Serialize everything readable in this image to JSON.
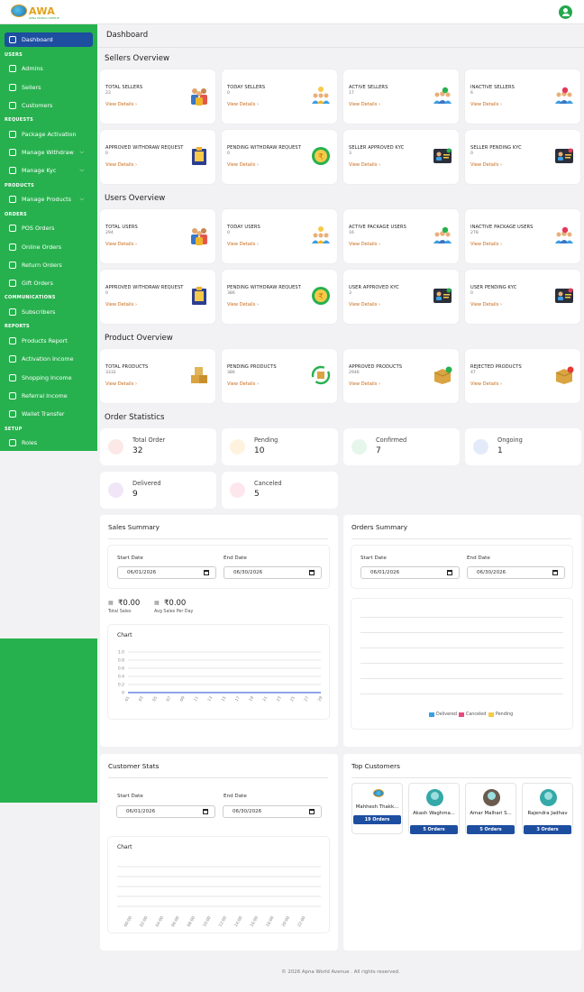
{
  "app": {
    "brand": "AWA",
    "tagline": "APNA WORLD AVENUE",
    "page_title": "Dashboard"
  },
  "sidebar": {
    "sections": [
      "USERS",
      "REQUESTS",
      "PRODUCTS",
      "ORDERS",
      "COMMUNICATIONS",
      "REPORTS",
      "SETUP"
    ],
    "items": [
      {
        "label": "Dashboard",
        "icon": "grid-icon"
      },
      {
        "label": "Admins",
        "icon": "admin-icon"
      },
      {
        "label": "Sellers",
        "icon": "sellers-icon"
      },
      {
        "label": "Customers",
        "icon": "customers-icon"
      },
      {
        "label": "Package Activation",
        "icon": "package-icon"
      },
      {
        "label": "Manage Withdraw",
        "icon": "withdraw-icon"
      },
      {
        "label": "Manage Kyc",
        "icon": "kyc-icon"
      },
      {
        "label": "Manage Products",
        "icon": "products-icon"
      },
      {
        "label": "POS Orders",
        "icon": "pos-icon"
      },
      {
        "label": "Online Orders",
        "icon": "online-orders-icon"
      },
      {
        "label": "Return Orders",
        "icon": "return-icon"
      },
      {
        "label": "Gift Orders",
        "icon": "gift-icon"
      },
      {
        "label": "Subscribers",
        "icon": "subscribers-icon"
      },
      {
        "label": "Products Report",
        "icon": "report-icon"
      },
      {
        "label": "Activation Income",
        "icon": "activation-icon"
      },
      {
        "label": "Shopping Income",
        "icon": "shopping-icon"
      },
      {
        "label": "Referral Income",
        "icon": "referral-icon"
      },
      {
        "label": "Wallet Transfer",
        "icon": "wallet-icon"
      },
      {
        "label": "Roles",
        "icon": "roles-icon"
      }
    ]
  },
  "sections": {
    "sellers": "Sellers Overview",
    "users": "Users Overview",
    "products": "Product Overview",
    "orders": "Order Statistics"
  },
  "view_details": "View Details",
  "sellers_cards": [
    {
      "label": "TOTAL SELLERS",
      "value": "23"
    },
    {
      "label": "TODAY SELLERS",
      "value": "0"
    },
    {
      "label": "ACTIVE SELLERS",
      "value": "17"
    },
    {
      "label": "INACTIVE SELLERS",
      "value": "6"
    },
    {
      "label": "APPROVED WITHDRAW REQUEST",
      "value": "0"
    },
    {
      "label": "PENDING WITHDRAW REQUEST",
      "value": "0"
    },
    {
      "label": "SELLER APPROVED KYC",
      "value": "3"
    },
    {
      "label": "SELLER PENDING KYC",
      "value": "0"
    }
  ],
  "users_cards": [
    {
      "label": "TOTAL USERS",
      "value": "294"
    },
    {
      "label": "TODAY USERS",
      "value": "0"
    },
    {
      "label": "ACTIVE PACKAGE USERS",
      "value": "16"
    },
    {
      "label": "INACTIVE PACKAGE USERS",
      "value": "278"
    },
    {
      "label": "APPROVED WITHDRAW REQUEST",
      "value": "0"
    },
    {
      "label": "PENDING WITHDRAW REQUEST",
      "value": "386"
    },
    {
      "label": "USER APPROVED KYC",
      "value": "3"
    },
    {
      "label": "USER PENDING KYC",
      "value": "0"
    }
  ],
  "product_cards": [
    {
      "label": "TOTAL PRODUCTS",
      "value": "3332"
    },
    {
      "label": "PENDING PRODUCTS",
      "value": "386"
    },
    {
      "label": "APPROVED PRODUCTS",
      "value": "2946"
    },
    {
      "label": "REJECTED PRODUCTS",
      "value": "47"
    }
  ],
  "order_stats": [
    {
      "label": "Total Order",
      "value": "32",
      "color": "#e53935"
    },
    {
      "label": "Pending",
      "value": "10",
      "color": "#f5a623"
    },
    {
      "label": "Confirmed",
      "value": "7",
      "color": "#27b14e"
    },
    {
      "label": "Ongoing",
      "value": "1",
      "color": "#1d4ea0"
    },
    {
      "label": "Delivered",
      "value": "9",
      "color": "#8e44ad"
    },
    {
      "label": "Canceled",
      "value": "5",
      "color": "#e53958"
    }
  ],
  "sales_summary": {
    "title": "Sales Summary",
    "start_label": "Start Date",
    "start_value": "06/01/2026",
    "end_label": "End Date",
    "end_value": "06/30/2026",
    "total_sales": "₹0.00",
    "total_sales_label": "Total Sales",
    "avg_sales": "₹0.00",
    "avg_sales_label": "Avg Sales Per Day",
    "chart_title": "Chart"
  },
  "orders_summary": {
    "title": "Orders Summary",
    "start_label": "Start Date",
    "start_value": "06/01/2026",
    "end_label": "End Date",
    "end_value": "06/30/2026"
  },
  "customer_stats": {
    "title": "Customer Stats",
    "start_label": "Start Date",
    "start_value": "06/01/2026",
    "end_label": "End Date",
    "end_value": "06/30/2026",
    "chart_title": "Chart"
  },
  "top_customers": {
    "title": "Top Customers",
    "items": [
      {
        "name": "Mahhesh Thakk...",
        "orders": "19 Orders"
      },
      {
        "name": "Akash Waghma...",
        "orders": "5 Orders"
      },
      {
        "name": "Amar Malhari S...",
        "orders": "5 Orders"
      },
      {
        "name": "Rajendra Jadhav",
        "orders": "3 Orders"
      }
    ]
  },
  "chart_data": [
    {
      "type": "line",
      "title": "Chart",
      "x": [
        "01",
        "03",
        "05",
        "07",
        "09",
        "11",
        "13",
        "15",
        "17",
        "19",
        "21",
        "23",
        "25",
        "27",
        "29"
      ],
      "series": [
        {
          "values": [
            0,
            0,
            0,
            0,
            0,
            0,
            0,
            0,
            0,
            0,
            0,
            0,
            0,
            0,
            0
          ]
        }
      ],
      "yticks": [
        "1.0",
        "0.8",
        "0.6",
        "0.4",
        "0.2",
        "0"
      ],
      "ylim": [
        0,
        1
      ]
    },
    {
      "type": "bar",
      "legend": [
        "Delivered",
        "Canceled",
        "Pending"
      ],
      "legend_colors": [
        "#3a9ee4",
        "#e84a7f",
        "#f7c948"
      ],
      "legend_position": "bottom",
      "series": [
        {
          "name": "Delivered",
          "values": []
        },
        {
          "name": "Canceled",
          "values": []
        },
        {
          "name": "Pending",
          "values": []
        }
      ]
    },
    {
      "type": "line",
      "title": "Chart",
      "x": [
        "00:00",
        "02:00",
        "04:00",
        "06:00",
        "08:00",
        "10:00",
        "12:00",
        "14:00",
        "16:00",
        "18:00",
        "20:00",
        "22:00"
      ],
      "series": []
    }
  ],
  "footer": "© 2026 Apna World Avenue . All rights reserved."
}
